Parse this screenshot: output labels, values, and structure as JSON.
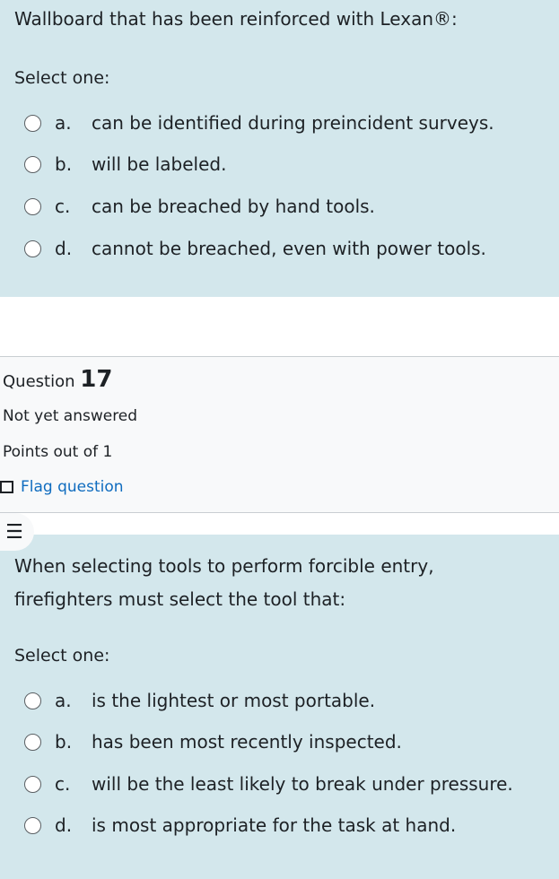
{
  "q16": {
    "text": "Wallboard that has been reinforced with Lexan®:",
    "select_label": "Select one:",
    "options": [
      {
        "letter": "a.",
        "text": "can be identified during preincident surveys."
      },
      {
        "letter": "b.",
        "text": "will be labeled."
      },
      {
        "letter": "c.",
        "text": "can be breached by hand tools."
      },
      {
        "letter": "d.",
        "text": "cannot be breached, even with power tools."
      }
    ]
  },
  "q17": {
    "label": "Question",
    "number": "17",
    "state": "Not yet answered",
    "grade": "Points out of 1",
    "flag": "Flag question",
    "drawer_icon": "☰",
    "text_line1": "When selecting tools to perform forcible entry,",
    "text_line2": "firefighters must select the tool that:",
    "select_label": "Select one:",
    "options": [
      {
        "letter": "a.",
        "text": "is the lightest or most portable."
      },
      {
        "letter": "b.",
        "text": "has been most recently inspected."
      },
      {
        "letter": "c.",
        "text": "will be the least likely to break under pressure."
      },
      {
        "letter": "d.",
        "text": "is most appropriate for the task at hand."
      }
    ]
  }
}
